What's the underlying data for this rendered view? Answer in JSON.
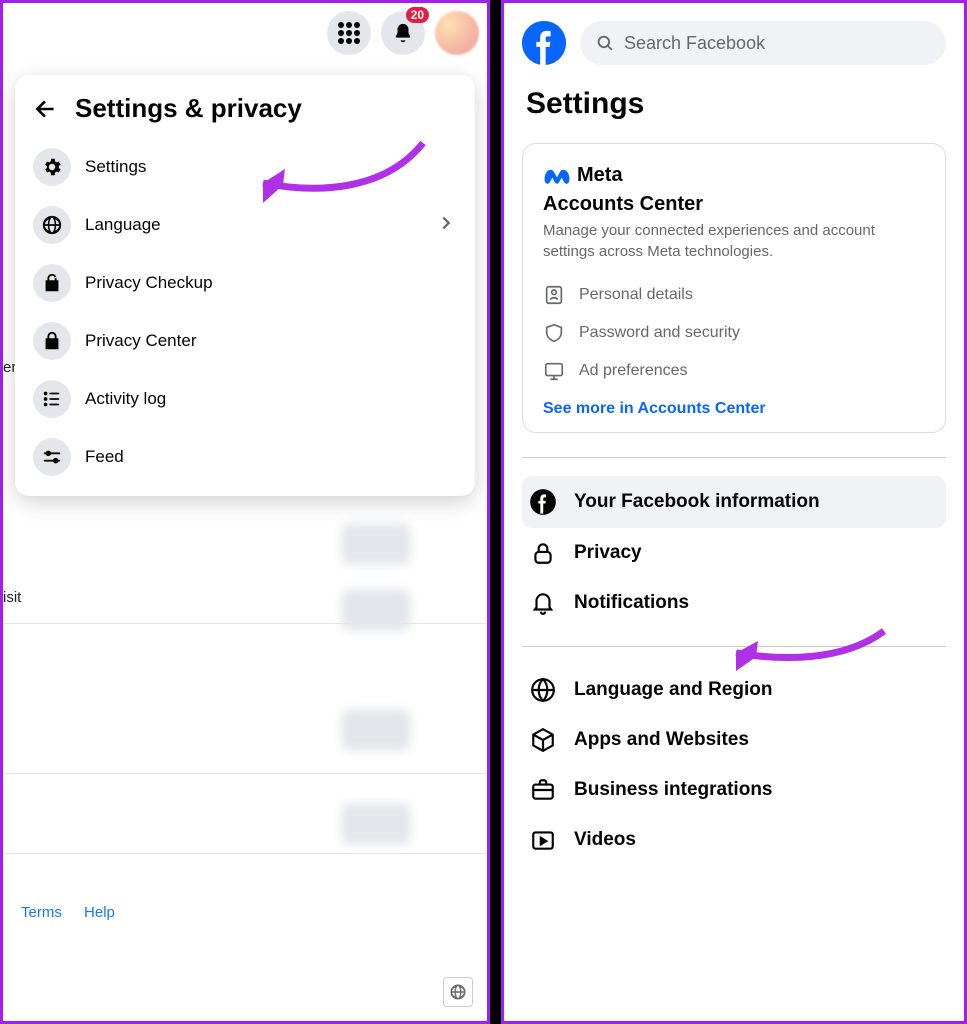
{
  "left": {
    "badge": "20",
    "title": "Settings & privacy",
    "menu": [
      {
        "label": "Settings"
      },
      {
        "label": "Language"
      },
      {
        "label": "Privacy Checkup"
      },
      {
        "label": "Privacy Center"
      },
      {
        "label": "Activity log"
      },
      {
        "label": "Feed"
      }
    ],
    "bg_text_1": "er",
    "bg_text_2": "isit",
    "footer": {
      "terms": "Terms",
      "help": "Help"
    }
  },
  "right": {
    "search_placeholder": "Search Facebook",
    "title": "Settings",
    "meta": {
      "brand": "Meta",
      "heading": "Accounts Center",
      "desc": "Manage your connected experiences and account settings across Meta technologies.",
      "rows": [
        {
          "label": "Personal details"
        },
        {
          "label": "Password and security"
        },
        {
          "label": "Ad preferences"
        }
      ],
      "link": "See more in Accounts Center"
    },
    "sections_a": [
      {
        "label": "Your Facebook information",
        "active": true
      },
      {
        "label": "Privacy"
      },
      {
        "label": "Notifications"
      }
    ],
    "sections_b": [
      {
        "label": "Language and Region"
      },
      {
        "label": "Apps and Websites"
      },
      {
        "label": "Business integrations"
      },
      {
        "label": "Videos"
      }
    ]
  }
}
